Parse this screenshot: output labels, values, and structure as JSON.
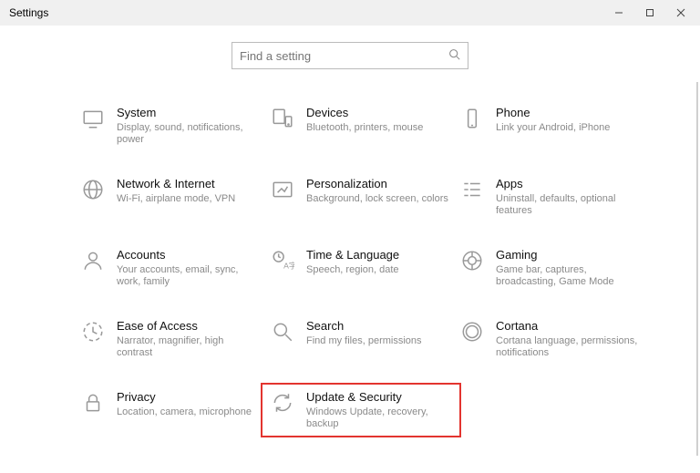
{
  "titlebar": {
    "title": "Settings"
  },
  "search": {
    "placeholder": "Find a setting"
  },
  "tiles": {
    "system": {
      "title": "System",
      "desc": "Display, sound, notifications, power"
    },
    "devices": {
      "title": "Devices",
      "desc": "Bluetooth, printers, mouse"
    },
    "phone": {
      "title": "Phone",
      "desc": "Link your Android, iPhone"
    },
    "network": {
      "title": "Network & Internet",
      "desc": "Wi-Fi, airplane mode, VPN"
    },
    "personal": {
      "title": "Personalization",
      "desc": "Background, lock screen, colors"
    },
    "apps": {
      "title": "Apps",
      "desc": "Uninstall, defaults, optional features"
    },
    "accounts": {
      "title": "Accounts",
      "desc": "Your accounts, email, sync, work, family"
    },
    "time": {
      "title": "Time & Language",
      "desc": "Speech, region, date"
    },
    "gaming": {
      "title": "Gaming",
      "desc": "Game bar, captures, broadcasting, Game Mode"
    },
    "ease": {
      "title": "Ease of Access",
      "desc": "Narrator, magnifier, high contrast"
    },
    "search": {
      "title": "Search",
      "desc": "Find my files, permissions"
    },
    "cortana": {
      "title": "Cortana",
      "desc": "Cortana language, permissions, notifications"
    },
    "privacy": {
      "title": "Privacy",
      "desc": "Location, camera, microphone"
    },
    "update": {
      "title": "Update & Security",
      "desc": "Windows Update, recovery, backup"
    }
  }
}
